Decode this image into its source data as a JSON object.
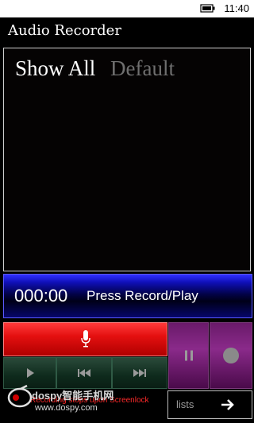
{
  "status_bar": {
    "time": "11:40"
  },
  "app": {
    "title": "Audio Recorder"
  },
  "filters": {
    "show_all": "Show All",
    "default": "Default"
  },
  "player": {
    "time": "000:00",
    "status": "Press Record/Play"
  },
  "footer": {
    "warning": "Recording stops upon Screenlock",
    "list_label": "lists"
  },
  "watermark": {
    "name": "dospy智能手机网",
    "url": "www.dospy.com"
  },
  "colors": {
    "record": "#e41010",
    "playback": "#0e2a1c",
    "pause_stop": "#8a2a8a",
    "time_panel": "#1010b8"
  },
  "icons": [
    "battery-charging-icon",
    "microphone-icon",
    "play-icon",
    "skip-previous-icon",
    "skip-next-icon",
    "pause-icon",
    "stop-icon",
    "arrow-right-icon"
  ]
}
